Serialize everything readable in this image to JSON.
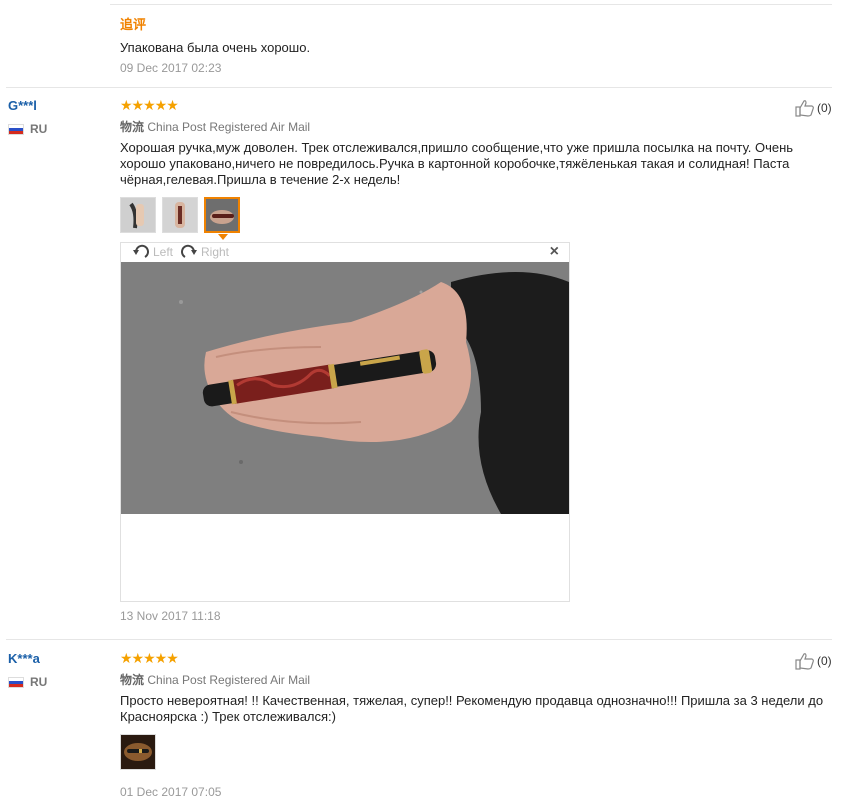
{
  "top_review": {
    "additional_label": "追评",
    "text": "Упакована была очень хорошо.",
    "date": "09 Dec 2017 02:23"
  },
  "reviews": [
    {
      "user": "G***l",
      "country": "RU",
      "rating": 5,
      "stars": "★★★★★",
      "shipping_label": "物流",
      "shipping": "China Post Registered Air Mail",
      "text": "Хорошая ручка,муж доволен. Трек отслеживался,пришло сообщение,что уже пришла посылка на почту. Очень хорошо упаковано,ничего не повредилось.Ручка в картонной коробочке,тяжёленькая такая и солидная! Паста чёрная,гелевая.Пришла в течение 2-х недель!",
      "likes": "(0)",
      "viewer": {
        "left_label": "Left",
        "right_label": "Right",
        "close": "×"
      },
      "date": "13 Nov 2017 11:18"
    },
    {
      "user": "K***a",
      "country": "RU",
      "rating": 5,
      "stars": "★★★★★",
      "shipping_label": "物流",
      "shipping": "China Post Registered Air Mail",
      "text": "Просто невероятная! !! Качественная, тяжелая, супер!! Рекомендую продавца однозначно!!! Пришла за 3 недели до Красноярска :) Трек отслеживался:)",
      "likes": "(0)",
      "date": "01 Dec 2017 07:05"
    }
  ],
  "colors": {
    "accent": "#f08200",
    "user": "#1a5fa8",
    "star": "#f5a100"
  }
}
